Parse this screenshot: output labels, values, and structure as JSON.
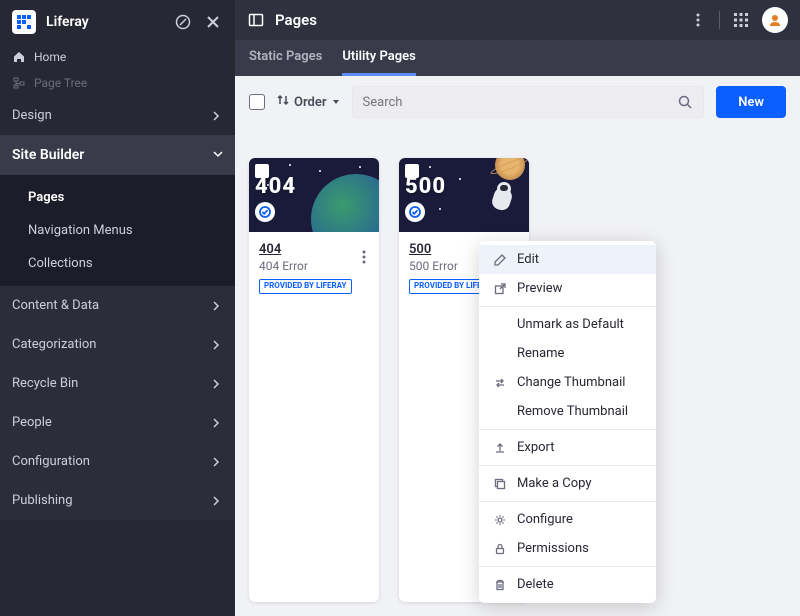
{
  "brand": "Liferay",
  "sidebar_top": {
    "home": "Home",
    "page_tree": "Page Tree"
  },
  "sidebar_sections": {
    "design": "Design",
    "site_builder": "Site Builder",
    "content_data": "Content & Data",
    "categorization": "Categorization",
    "recycle_bin": "Recycle Bin",
    "people": "People",
    "configuration": "Configuration",
    "publishing": "Publishing"
  },
  "site_builder_items": {
    "pages": "Pages",
    "nav_menus": "Navigation Menus",
    "collections": "Collections"
  },
  "page_title": "Pages",
  "tabs": {
    "static": "Static Pages",
    "utility": "Utility Pages"
  },
  "toolbar": {
    "order": "Order",
    "search_placeholder": "Search",
    "new": "New"
  },
  "cards": [
    {
      "big": "404",
      "title": "404",
      "sub": "404 Error",
      "badge": "PROVIDED BY LIFERAY"
    },
    {
      "big": "500",
      "title": "500",
      "sub": "500 Error",
      "badge": "PROVIDED BY LIFERAY"
    }
  ],
  "menu": {
    "edit": "Edit",
    "preview": "Preview",
    "unmark": "Unmark as Default",
    "rename": "Rename",
    "change_thumb": "Change Thumbnail",
    "remove_thumb": "Remove Thumbnail",
    "export": "Export",
    "copy": "Make a Copy",
    "configure": "Configure",
    "permissions": "Permissions",
    "delete": "Delete"
  }
}
